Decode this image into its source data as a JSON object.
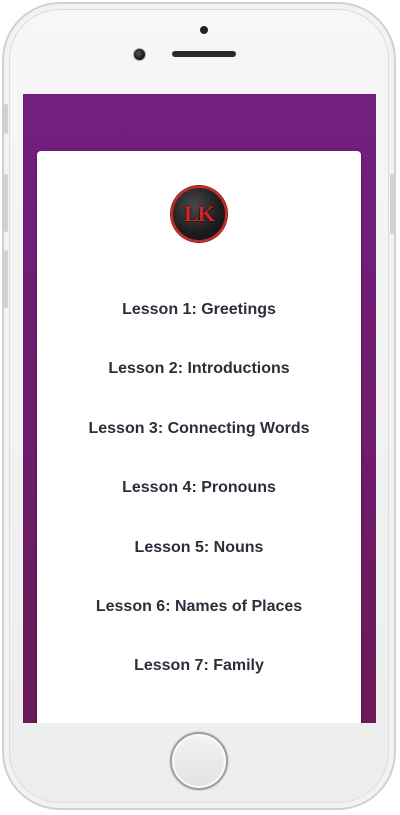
{
  "app": {
    "logo_text": "LK"
  },
  "lessons": [
    {
      "label": "Lesson 1: Greetings"
    },
    {
      "label": "Lesson 2: Introductions"
    },
    {
      "label": "Lesson 3: Connecting Words"
    },
    {
      "label": "Lesson 4: Pronouns"
    },
    {
      "label": "Lesson 5: Nouns"
    },
    {
      "label": "Lesson 6: Names of Places"
    },
    {
      "label": "Lesson 7: Family"
    }
  ],
  "colors": {
    "header_purple": "#721f7f",
    "logo_red": "#d32222",
    "text_dark": "#2a2f3a"
  },
  "icons": {
    "camera": "front-camera-icon",
    "home": "home-button-icon"
  }
}
